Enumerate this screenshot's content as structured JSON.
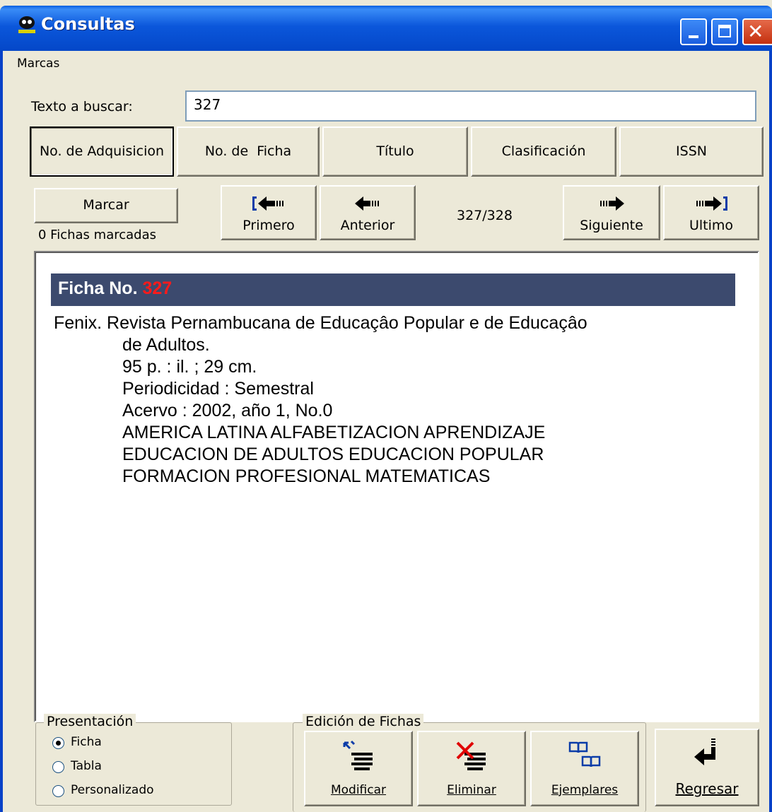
{
  "window": {
    "title": "Consultas",
    "title_icon": "app-logo-icon",
    "controls": [
      "minimize-icon",
      "maximize-icon",
      "close-icon"
    ]
  },
  "menu": {
    "items": [
      {
        "label": "Marcas"
      }
    ]
  },
  "search": {
    "label": "Texto a buscar:",
    "value": "327"
  },
  "search_fields": [
    {
      "label": "No. de Adquisicion",
      "selected": true
    },
    {
      "label": "No. de  Ficha",
      "selected": false
    },
    {
      "label": "Título",
      "selected": false
    },
    {
      "label": "Clasificación",
      "selected": false
    },
    {
      "label": "ISSN",
      "selected": false
    }
  ],
  "marking": {
    "button": "Marcar",
    "status": "0 Fichas marcadas"
  },
  "navigation": {
    "first": "Primero",
    "previous": "Anterior",
    "position": "327/328",
    "next": "Siguiente",
    "last": "Ultimo"
  },
  "record": {
    "header_label": "Ficha No.",
    "number": "327",
    "lines": [
      "Fenix. Revista Pernambucana de Educaçâo Popular e de Educaçâo",
      "de Adultos.",
      "95 p. : il. ; 29 cm.",
      "Periodicidad : Semestral",
      "Acervo : 2002, año 1, No.0",
      "AMERICA LATINA ALFABETIZACION APRENDIZAJE",
      "EDUCACION DE ADULTOS EDUCACION POPULAR",
      "FORMACION PROFESIONAL MATEMATICAS"
    ]
  },
  "presentation": {
    "legend": "Presentación",
    "options": [
      {
        "label": "Ficha",
        "selected": true
      },
      {
        "label": "Tabla",
        "selected": false
      },
      {
        "label": "Personalizado",
        "selected": false
      }
    ]
  },
  "edition": {
    "legend": "Edición de Fichas",
    "buttons": [
      {
        "label": "Modificar",
        "icon": "modify-icon"
      },
      {
        "label": "Eliminar",
        "icon": "delete-icon"
      },
      {
        "label": "Ejemplares",
        "icon": "copies-books-icon"
      }
    ]
  },
  "back_button": {
    "label": "Regresar",
    "icon": "return-arrow-icon"
  },
  "colors": {
    "titlebar": "#0b57db",
    "record_header_bg": "#3c4a6e",
    "record_number": "#ff1a1a",
    "nav_bracket": "#0a3ca8",
    "delete_x": "#e00000"
  }
}
